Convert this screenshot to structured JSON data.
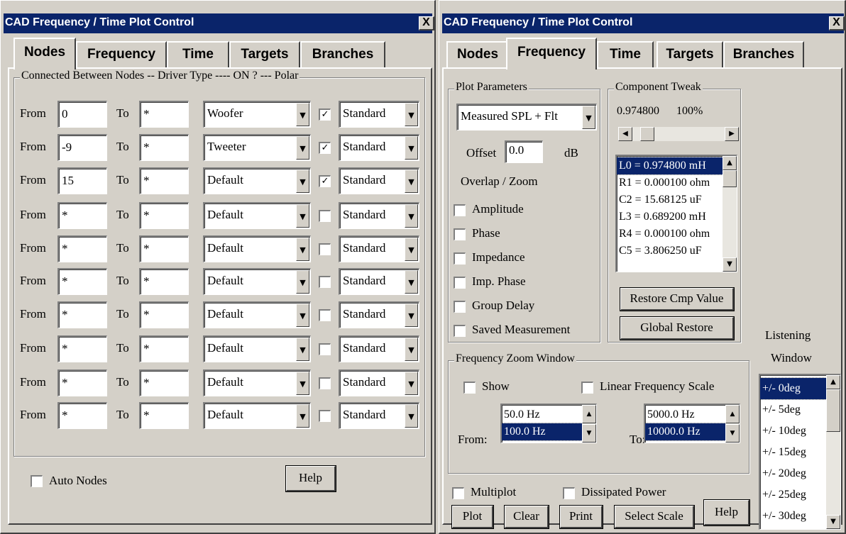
{
  "left_window": {
    "title": "CAD Frequency / Time Plot Control",
    "close_label": "X",
    "tabs": [
      "Nodes",
      "Frequency",
      "Time",
      "Targets",
      "Branches"
    ],
    "active_tab": "Nodes",
    "group_label": "Connected Between Nodes -- Driver Type ---- ON ? --- Polar",
    "from_label": "From",
    "to_label": "To",
    "rows": [
      {
        "from": "0",
        "to": "*",
        "driver": "Woofer",
        "on": true,
        "polar": "Standard"
      },
      {
        "from": "-9",
        "to": "*",
        "driver": "Tweeter",
        "on": true,
        "polar": "Standard"
      },
      {
        "from": "15",
        "to": "*",
        "driver": "Default",
        "on": true,
        "polar": "Standard"
      },
      {
        "from": "*",
        "to": "*",
        "driver": "Default",
        "on": false,
        "polar": "Standard"
      },
      {
        "from": "*",
        "to": "*",
        "driver": "Default",
        "on": false,
        "polar": "Standard"
      },
      {
        "from": "*",
        "to": "*",
        "driver": "Default",
        "on": false,
        "polar": "Standard"
      },
      {
        "from": "*",
        "to": "*",
        "driver": "Default",
        "on": false,
        "polar": "Standard"
      },
      {
        "from": "*",
        "to": "*",
        "driver": "Default",
        "on": false,
        "polar": "Standard"
      },
      {
        "from": "*",
        "to": "*",
        "driver": "Default",
        "on": false,
        "polar": "Standard"
      },
      {
        "from": "*",
        "to": "*",
        "driver": "Default",
        "on": false,
        "polar": "Standard"
      }
    ],
    "auto_nodes_label": "Auto Nodes",
    "auto_nodes_checked": false,
    "help_label": "Help"
  },
  "right_window": {
    "title": "CAD Frequency / Time Plot Control",
    "close_label": "X",
    "tabs": [
      "Nodes",
      "Frequency",
      "Time",
      "Targets",
      "Branches"
    ],
    "active_tab": "Frequency",
    "plot_parameters": {
      "label": "Plot Parameters",
      "selected": "Measured SPL + Flt",
      "offset_label": "Offset",
      "offset_value": "0.0",
      "offset_unit": "dB",
      "overlap_label": "Overlap / Zoom",
      "checkboxes": [
        {
          "label": "Amplitude",
          "checked": false
        },
        {
          "label": "Phase",
          "checked": false
        },
        {
          "label": "Impedance",
          "checked": false
        },
        {
          "label": "Imp. Phase",
          "checked": false
        },
        {
          "label": "Group Delay",
          "checked": false
        },
        {
          "label": "Saved Measurement",
          "checked": false
        }
      ]
    },
    "component_tweak": {
      "label": "Component Tweak",
      "value": "0.974800",
      "percent": "100%",
      "slider_position": 0.1,
      "components": [
        "L0 = 0.974800 mH",
        "R1 = 0.000100 ohm",
        "C2 = 15.68125 uF",
        "L3 = 0.689200 mH",
        "R4 = 0.000100 ohm",
        "C5 = 3.806250 uF"
      ],
      "selected_index": 0,
      "restore_label": "Restore Cmp Value",
      "global_restore_label": "Global Restore"
    },
    "frequency_zoom": {
      "label": "Frequency Zoom Window",
      "show_label": "Show",
      "show_checked": false,
      "linear_label": "Linear Frequency Scale",
      "linear_checked": false,
      "from_label": "From:",
      "from_options": [
        "50.0 Hz",
        "100.0 Hz"
      ],
      "from_selected_index": 1,
      "to_label": "To:",
      "to_options": [
        "5000.0 Hz",
        "10000.0 Hz"
      ],
      "to_selected_index": 1
    },
    "listening_window": {
      "label_line1": "Listening",
      "label_line2": "Window",
      "items": [
        "+/- 0deg",
        "+/- 5deg",
        "+/- 10deg",
        "+/- 15deg",
        "+/- 20deg",
        "+/- 25deg",
        "+/- 30deg"
      ],
      "selected_index": 0
    },
    "multiplot_label": "Multiplot",
    "multiplot_checked": false,
    "dissipated_label": "Dissipated Power",
    "dissipated_checked": false,
    "buttons": {
      "plot": "Plot",
      "clear": "Clear",
      "print": "Print",
      "select_scale": "Select Scale",
      "help": "Help"
    }
  }
}
